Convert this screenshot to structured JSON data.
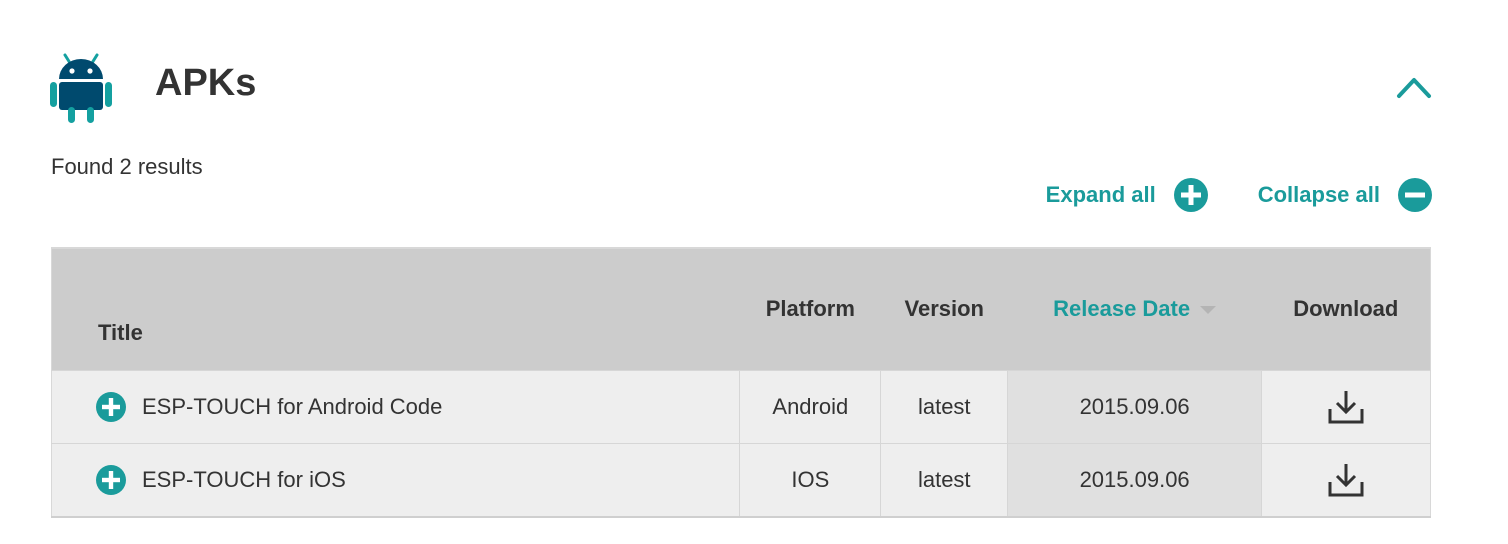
{
  "section": {
    "title": "APKs",
    "icon": "android-icon",
    "collapse_icon": "chevron-up-icon"
  },
  "results": {
    "summary": "Found 2 results"
  },
  "toggles": {
    "expand_label": "Expand all",
    "collapse_label": "Collapse all"
  },
  "table": {
    "headers": {
      "title": "Title",
      "platform": "Platform",
      "version": "Version",
      "release_date": "Release Date",
      "download": "Download"
    },
    "sorted_column": "release_date",
    "rows": [
      {
        "title": "ESP-TOUCH for Android Code",
        "platform": "Android",
        "version": "latest",
        "release_date": "2015.09.06"
      },
      {
        "title": "ESP-TOUCH for iOS",
        "platform": "IOS",
        "version": "latest",
        "release_date": "2015.09.06"
      }
    ]
  },
  "colors": {
    "accent": "#1a9b9b",
    "android_blue": "#004a6e",
    "android_teal": "#14a0a0",
    "header_bg": "#cccccc",
    "row_bg": "#eeeeee",
    "sorted_col_bg": "#e0e0e0"
  }
}
